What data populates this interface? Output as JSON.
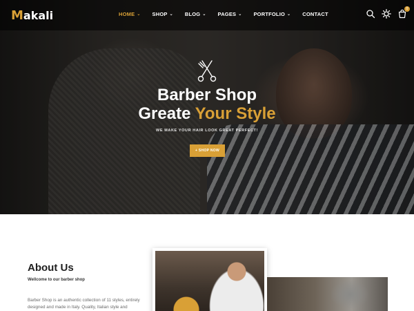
{
  "brand": {
    "logo_first": "M",
    "logo_rest": "akali",
    "accent_color": "#d9a036"
  },
  "nav": {
    "items": [
      {
        "label": "HOME",
        "has_dropdown": true,
        "active": true
      },
      {
        "label": "SHOP",
        "has_dropdown": true,
        "active": false
      },
      {
        "label": "BLOG",
        "has_dropdown": true,
        "active": false
      },
      {
        "label": "PAGES",
        "has_dropdown": true,
        "active": false
      },
      {
        "label": "PORTFOLIO",
        "has_dropdown": true,
        "active": false
      },
      {
        "label": "CONTACT",
        "has_dropdown": false,
        "active": false
      }
    ],
    "icons": [
      "search-icon",
      "settings-icon",
      "cart-icon"
    ],
    "cart_count": "0"
  },
  "hero": {
    "title_line1": "Barber Shop",
    "title_line2_plain": "Greate ",
    "title_line2_accent": "Your Style",
    "subtitle": "WE MAKE YOUR HAIR LOOK GREAT PERFECT!",
    "button_label": "+ SHOP NOW",
    "icon": "scissors-comb-icon"
  },
  "about": {
    "heading": "About Us",
    "subheading": "Wellcome to our barber shop",
    "text": "Barber Shop is an authentic collection of 11 styles, entirely designed and made in Italy. Quality, Italian style and"
  }
}
